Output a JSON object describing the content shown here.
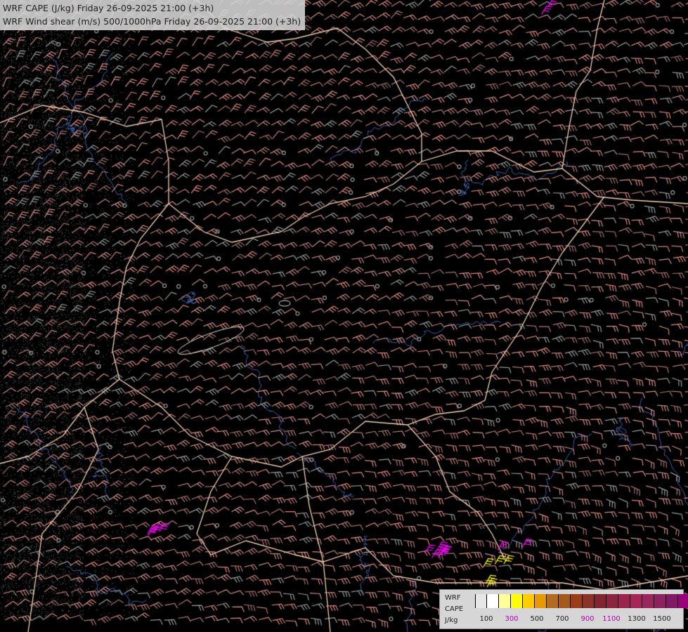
{
  "header": {
    "line1": "WRF CAPE (J/kg) Friday 26-09-2025 21:00 (+3h)",
    "line2": "WRF Wind shear (m/s) 500/1000hPa Friday 26-09-2025 21:00 (+3h)"
  },
  "legend": {
    "title1": "WRF",
    "title2": "CAPE",
    "unit": "J/kg",
    "swatch_colors": [
      "#e6e6e6",
      "#ffffff",
      "#ffff99",
      "#ffff00",
      "#ffcc00",
      "#e69900",
      "#b36b1f",
      "#a35a1a",
      "#993d1a",
      "#8c3326",
      "#802633",
      "#8c2640",
      "#99264d",
      "#a6265a",
      "#99265c",
      "#8c2260",
      "#801a66",
      "#99007a",
      "#a0006e"
    ],
    "tick_labels": [
      {
        "text": "100",
        "color": "#222222"
      },
      {
        "text": "300",
        "color": "#b000b0"
      },
      {
        "text": "500",
        "color": "#222222"
      },
      {
        "text": "700",
        "color": "#222222"
      },
      {
        "text": "900",
        "color": "#b000b0"
      },
      {
        "text": "1100",
        "color": "#b000b0"
      },
      {
        "text": "1300",
        "color": "#222222"
      },
      {
        "text": "1500",
        "color": "#222222"
      }
    ]
  },
  "map": {
    "background": "#000000",
    "border_color": "#f2d2b0",
    "river_color": "#3a5fa8",
    "barb_colors": [
      "#c98585",
      "#b87a7a",
      "#d49090",
      "#a46f6f",
      "#e08a80",
      "#9a9a9a"
    ],
    "cape_colors": [
      "#ff00ff",
      "#ffff00",
      "#ffffff"
    ]
  }
}
